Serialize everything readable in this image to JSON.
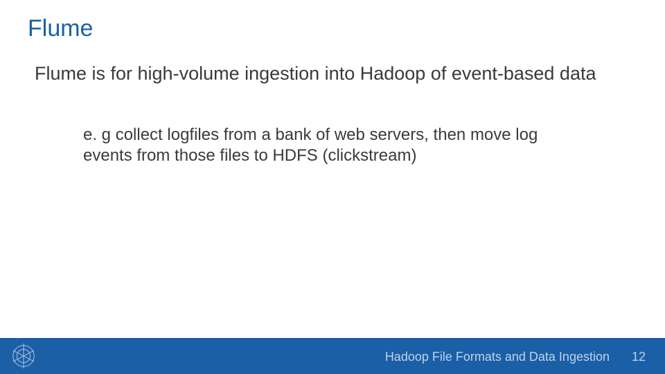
{
  "slide": {
    "title": "Flume",
    "subtitle": "Flume is for high-volume ingestion into Hadoop of event-based data",
    "body": "e. g collect logfiles from a bank of web servers, then move log events from those files to HDFS (clickstream)"
  },
  "footer": {
    "title": "Hadoop File Formats and Data Ingestion",
    "page_number": "12"
  },
  "colors": {
    "accent": "#1b5fa6",
    "text": "#3a3a3a",
    "footer_text": "#bcd3eb"
  }
}
